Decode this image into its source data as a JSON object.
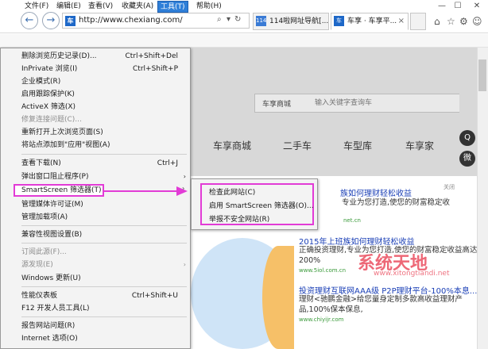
{
  "browser": {
    "address_url": "http://www.chexiang.com/",
    "address_favicon": "车",
    "tabs": [
      {
        "label": "114啦网址导航[...",
        "favicon": "114"
      },
      {
        "label": "车享 · 车享平...",
        "favicon": "车"
      }
    ],
    "window_controls": [
      "—",
      "☐",
      "✕"
    ],
    "toolbar_icons": [
      "home-icon",
      "star-icon",
      "gear-icon",
      "smiley-icon"
    ]
  },
  "menubar": {
    "items": [
      "文件(F)",
      "编辑(E)",
      "查看(V)",
      "收藏夹(A)",
      "工具(T)",
      "帮助(H)"
    ],
    "active": "工具(T)"
  },
  "tools_menu": {
    "items": [
      {
        "label": "删除浏览历史记录(D)...",
        "shortcut": "Ctrl+Shift+Del"
      },
      {
        "label": "InPrivate 浏览(I)",
        "shortcut": "Ctrl+Shift+P"
      },
      {
        "label": "企业模式(R)",
        "shortcut": ""
      },
      {
        "label": "启用跟踪保护(K)",
        "shortcut": ""
      },
      {
        "label": "ActiveX 筛选(X)",
        "shortcut": ""
      },
      {
        "label": "修复连接问题(C)...",
        "shortcut": "",
        "disabled": true
      },
      {
        "label": "重新打开上次浏览页面(S)",
        "shortcut": ""
      },
      {
        "label": "将站点添加到\"应用\"视图(A)",
        "shortcut": ""
      },
      {
        "label": "查看下载(N)",
        "shortcut": "Ctrl+J"
      },
      {
        "label": "弹出窗口阻止程序(P)",
        "shortcut": "",
        "submenu": true
      },
      {
        "label": "SmartScreen 筛选器(T)",
        "shortcut": "",
        "submenu": true,
        "highlighted": true
      },
      {
        "label": "管理媒体许可证(M)",
        "shortcut": ""
      },
      {
        "label": "管理加载项(A)",
        "shortcut": ""
      },
      {
        "label": "兼容性视图设置(B)",
        "shortcut": ""
      },
      {
        "label": "订阅此源(F)...",
        "shortcut": "",
        "disabled": true
      },
      {
        "label": "源发现(E)",
        "shortcut": "",
        "disabled": true,
        "submenu": true
      },
      {
        "label": "Windows 更新(U)",
        "shortcut": ""
      },
      {
        "label": "性能仪表板",
        "shortcut": "Ctrl+Shift+U"
      },
      {
        "label": "F12 开发人员工具(L)",
        "shortcut": ""
      },
      {
        "label": "报告网站问题(R)",
        "shortcut": ""
      },
      {
        "label": "Internet 选项(O)",
        "shortcut": ""
      }
    ]
  },
  "smartscreen_submenu": {
    "items": [
      "检查此网站(C)",
      "启用 SmartScreen 筛选器(O)...",
      "举报不安全网站(R)"
    ]
  },
  "page": {
    "search_label": "车享商城",
    "search_placeholder": "输入关键字查询车",
    "categories": [
      "车享商城",
      "二手车",
      "车型库",
      "车享家"
    ],
    "side_icons": [
      "Q",
      "微"
    ]
  },
  "ads": {
    "close_label": "关闭",
    "items": [
      {
        "title": "族如何理财轻松收益",
        "body": "专业为您打造,使您的财富稳定收",
        "url": "net.cn"
      },
      {
        "title": "2015年上班族如何理财轻松收益",
        "body": "正确投资理财,专业为您打造,使您的财富稳定收益高达200%",
        "url": "www.5iol.com.cn"
      },
      {
        "title": "投资理财互联网AAA级 P2P理财平台-100%本息...",
        "body": "理财<驰鹏金融>给您量身定制多款高收益理财产品,100%保本保息,",
        "url": "www.chiyijr.com"
      }
    ]
  },
  "watermark": {
    "title": "系统天地",
    "url": "www.xitongtiandi.net"
  },
  "colors": {
    "highlight": "#e23bd6",
    "menu_active": "#2f7fd8",
    "link": "#1a3fb6"
  }
}
